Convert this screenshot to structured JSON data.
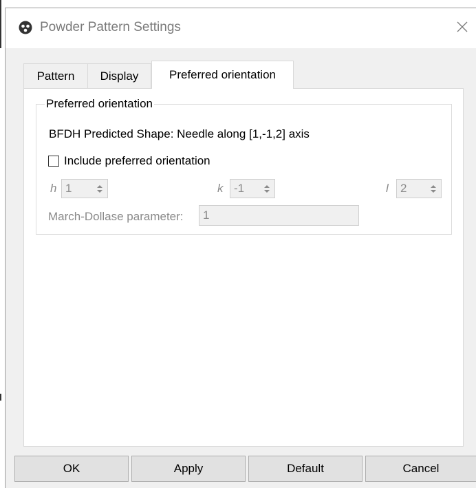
{
  "window": {
    "title": "Powder Pattern Settings",
    "app_icon": "app-logo-icon",
    "close_icon": "close-icon"
  },
  "tabs": [
    {
      "label": "Pattern",
      "active": false
    },
    {
      "label": "Display",
      "active": false
    },
    {
      "label": "Preferred orientation",
      "active": true
    }
  ],
  "group": {
    "title": "Preferred orientation",
    "shape_text": "BFDH Predicted Shape: Needle along [1,-1,2] axis",
    "include_label": "Include preferred orientation",
    "include_checked": false,
    "h_label": "h",
    "h_value": "1",
    "k_label": "k",
    "k_value": "-1",
    "l_label": "l",
    "l_value": "2",
    "md_label": "March-Dollase parameter:",
    "md_value": "1"
  },
  "buttons": {
    "ok": "OK",
    "apply": "Apply",
    "default": "Default",
    "cancel": "Cancel"
  }
}
